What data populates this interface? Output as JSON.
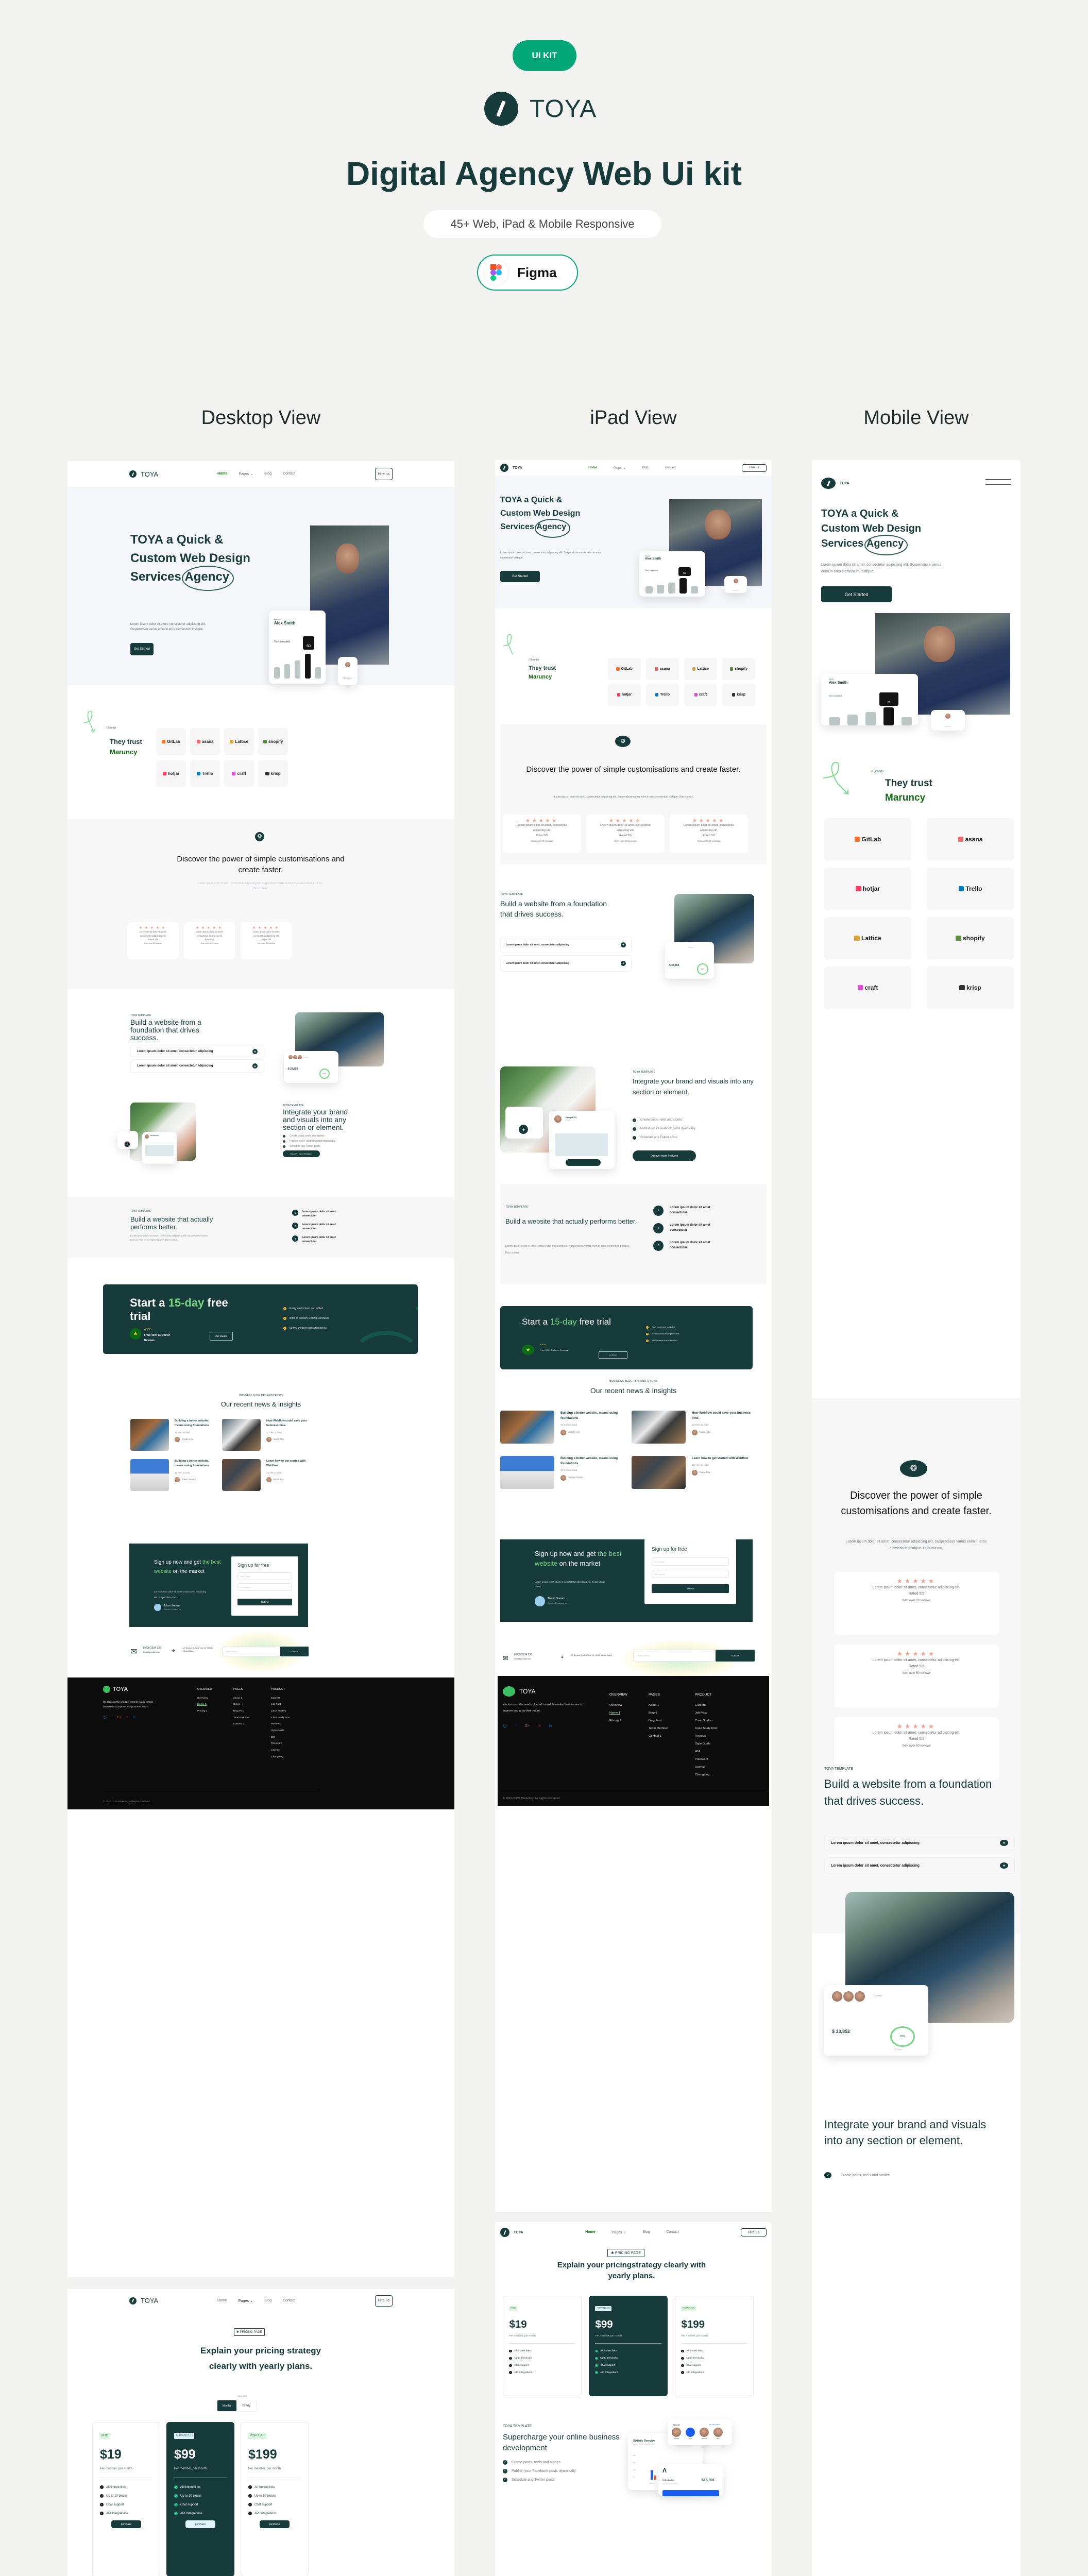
{
  "header": {
    "badge": "UI KIT",
    "brand": "TOYA",
    "title": "Digital Agency Web Ui kit",
    "responsive_pill": "45+ Web, iPad &  Mobile Responsive",
    "tool_label": "Figma"
  },
  "columns": [
    "Desktop View",
    "iPad View",
    "Mobile View"
  ],
  "colors": {
    "accent": "#04a777",
    "primary": "#173b3b",
    "green_text": "#146c14",
    "light_green": "#74d680",
    "star": "#f2a08b",
    "footer_bg": "#0c0c0c"
  },
  "nav": {
    "logo": "TOYA",
    "links": [
      "Home",
      "Pages",
      "Blog",
      "Contact"
    ],
    "active_home": "Home",
    "hire": "Hire us"
  },
  "hero": {
    "line1": "TOYA a Quick &",
    "line2": "Custom Web Design",
    "line3": "Services",
    "highlight": "Agency",
    "desc": "Lorem ipsum dolor sit amet, consectetur adipiscing elit. Suspendisse varius enim in eros elementum tristique.",
    "cta": "Get Started",
    "card_city": "Atlanta",
    "card_name": "Alex Smith",
    "card_label": "Tom investted",
    "card_value": "60",
    "card_manager": "Manager"
  },
  "brands": {
    "eyebrow": "Brands",
    "title_a": "They trust",
    "title_b": "Maruncy",
    "logos": [
      "GitLab",
      "asana",
      "Lattice",
      "shopify",
      "hotjar",
      "Trello",
      "craft",
      "krisp"
    ],
    "mobile_order": [
      "GitLab",
      "asana",
      "hotjar",
      "Trello",
      "Lattice",
      "shopify",
      "craft",
      "krisp"
    ]
  },
  "discover": {
    "title": "Discover the power of simple customisations and create faster.",
    "desc": "Lorem ipsum dolor sit amet, consectetur adipiscing elit. Suspendisse varius enim in eros elementum tristique. Duis cursus,",
    "stars": "★★★★★",
    "rating_value": 5,
    "review_text": "Lorem ipsum dolor sit amet, consectetur adipiscing elit.",
    "rated": "Rated 5/5",
    "from": "from over 60 reviews"
  },
  "feature1": {
    "eyebrow": "TOYA  TEMPLATE",
    "title": "Build a website from a foundation that drives success.",
    "items": [
      "Lorem ipsum dolor sit amet, consectetur adipiscing",
      "Lorem ipsum dolor sit amet, consectetur adipiscing"
    ],
    "owners": "3 owner",
    "amount": "$ 33,852",
    "percent": "70%",
    "hours": "120 Hours"
  },
  "feature2": {
    "eyebrow": "TOYA TEMPLATE",
    "title": "Integrate your brand and visuals into any section or element.",
    "items": [
      "Create posts, reels and stories",
      "Publish your Facebook posts dyamically",
      "Schedule any Twitter posts"
    ],
    "cta": "Discover more Features",
    "post_user": "Danlyal EO",
    "post_visibility": "Public"
  },
  "feature3": {
    "eyebrow": "TOYA TEMPLATE",
    "title": "Build a website that actually performs better.",
    "desc": "Lorem ipsum dolor sit amet, consectetur adipiscing elit. Suspendisse varius enim in eros elementum tristique. Duis cursus,",
    "steps": [
      {
        "n": "1",
        "text": "Lorem ipsum dolor sit amet consectutar"
      },
      {
        "n": "2",
        "text": "Lorem ipsum dolor sit amet consectutar"
      },
      {
        "n": "3",
        "text": "Lorem ipsum dolor sit amet consectutar"
      }
    ]
  },
  "trial": {
    "title_a": "Start a ",
    "title_hl": "15-day",
    "title_b": " free trial",
    "rating": "4.90/5",
    "reviews": "From 400+ Customer Reviews",
    "cta": "Get Started",
    "points": [
      "Easily customised and edited",
      "Build to industry leading standards",
      "99.9% cheaper than alternatives"
    ]
  },
  "blog": {
    "eyebrow": "BUSINESS BLOG TIPS AND TRICKS",
    "title": "Our recent news & insights",
    "posts": [
      {
        "title": "Building a better website, means using foundations",
        "read": "12 men to read",
        "author": "Josafe min"
      },
      {
        "title": "How Webflow could save your business time.",
        "read": "12 men to read",
        "author": "Manik Mie"
      },
      {
        "title": "Building a better website, means using foundations",
        "read": "12 men to read",
        "author": "Tokon Sonam"
      },
      {
        "title": "Learn how to get started with Webflow",
        "read": "12 men to read",
        "author": "Refat Roy"
      }
    ]
  },
  "signup": {
    "title_a": "Sign up now and get ",
    "title_hl": "the best website",
    "title_b": " on the market",
    "desc": "Lorem ipsum dolor sit amet, consectetur adipiscing elit. Suspendisse varius",
    "person": "Tokon Sonam",
    "role": "Director Flowbase.co",
    "form_title": "Sign up for free",
    "email_placeholder": "Your email",
    "name_placeholder": "Your Name",
    "submit": "Submit"
  },
  "contact": {
    "phone": "8 800 2534 236",
    "email": "email@yoursite.com",
    "address": "27 Division St, New York, NY 10002, United States",
    "newsletter_placeholder": "Email Address",
    "newsletter_submit": "SUBMIT"
  },
  "footer": {
    "logo": "TOYA",
    "about": "We focus on the needs of small to middle market businesses to improve and grow their return.",
    "socials": [
      "twitter",
      "facebook",
      "google-plus",
      "pinterest",
      "linkedin"
    ],
    "cols": [
      {
        "title": "OVERVIEW",
        "links": [
          "Overview",
          "Home 1",
          "Pricing 1"
        ]
      },
      {
        "title": "PAGES",
        "links": [
          "About 1",
          "Blog 1",
          "Blog Post",
          "Team Member",
          "Contact 1"
        ]
      },
      {
        "title": "PRODUCT",
        "links": [
          "Careers",
          "Job Post",
          "Case Studies",
          "Case Study Post",
          "Reviews",
          "Style Guide",
          "404",
          "Password",
          "Licence",
          "Changelog"
        ]
      }
    ],
    "copyright": "2022-TOYA Marketing. All Rights Reserved."
  },
  "pricing": {
    "tag": "PRICING PAGE",
    "title": "Explain your pricing strategy clearly with yearly plans.",
    "ipad_title": "Explain your pricingstrategy clearly with yearly plans.",
    "toggle": [
      "Monthly",
      "Yearly"
    ],
    "save_note": "Save 50%",
    "plans": [
      {
        "tag": "PRO",
        "price": "$19",
        "period": "Per member, per month",
        "features": [
          "All limited links",
          "Up to 10 blocks",
          "Chat support",
          "API Integrations"
        ],
        "cta": "purchase"
      },
      {
        "tag": "ADVANCED",
        "price": "$99",
        "period": "Per member, per month",
        "features": [
          "All limited links",
          "Up to 10 blocks",
          "Chat support",
          "API Integrations"
        ],
        "cta": "purchase"
      },
      {
        "tag": "POPULAR",
        "price": "$199",
        "period": "Per member, per month",
        "features": [
          "All limited links",
          "Up to 10 blocks",
          "Chat support",
          "API Integrations"
        ],
        "cta": "purchase"
      }
    ]
  },
  "supercharge": {
    "eyebrow": "TOYA  TEMPLATE",
    "title": "Supercharge your online business development",
    "items": [
      "Create posts, reels and stories",
      "Publish your Facebook posts dyamically",
      "Schedule any Twitter posts"
    ],
    "stat_title": "Statistic Overview",
    "stat_range": "Nov 1, 2020 - Nov 30, 2020",
    "stat_period": "Monthly",
    "stat_ticks": [
      "$5k",
      "$3k",
      "$1k",
      "$0"
    ],
    "stat_week": "Week 1",
    "recent": "Recent",
    "see_all": "See all contacts",
    "contacts": [
      "Dianna",
      "Cody",
      "Theresa",
      "Ben"
    ],
    "greeting": "Hello Andre,",
    "balance_label": "Your available balance",
    "balance": "$15,901"
  }
}
